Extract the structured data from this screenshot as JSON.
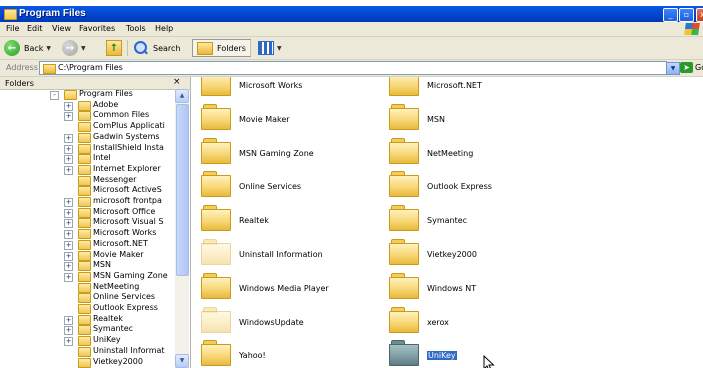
{
  "window": {
    "title": "Program Files",
    "buttons": {
      "minimize": "_",
      "maximize": "▫",
      "close": "x"
    }
  },
  "menu": [
    "File",
    "Edit",
    "View",
    "Favorites",
    "Tools",
    "Help"
  ],
  "toolbar": {
    "back": "Back",
    "search": "Search",
    "folders": "Folders"
  },
  "address": {
    "label": "Address",
    "value": "C:\\Program Files",
    "go": "Go"
  },
  "folders_pane": {
    "title": "Folders",
    "close": "×",
    "tree": [
      {
        "label": "Program Files",
        "expander": "-",
        "level": 0
      },
      {
        "label": "Adobe",
        "expander": "+",
        "level": 1
      },
      {
        "label": "Common Files",
        "expander": "+",
        "level": 1
      },
      {
        "label": "ComPlus Applicati",
        "expander": "",
        "level": 1
      },
      {
        "label": "Gadwin Systems",
        "expander": "+",
        "level": 1
      },
      {
        "label": "InstallShield Insta",
        "expander": "+",
        "level": 1
      },
      {
        "label": "Intel",
        "expander": "+",
        "level": 1
      },
      {
        "label": "Internet Explorer",
        "expander": "+",
        "level": 1
      },
      {
        "label": "Messenger",
        "expander": "",
        "level": 1
      },
      {
        "label": "Microsoft ActiveS",
        "expander": "",
        "level": 1
      },
      {
        "label": "microsoft frontpa",
        "expander": "+",
        "level": 1
      },
      {
        "label": "Microsoft Office",
        "expander": "+",
        "level": 1
      },
      {
        "label": "Microsoft Visual S",
        "expander": "+",
        "level": 1
      },
      {
        "label": "Microsoft Works",
        "expander": "+",
        "level": 1
      },
      {
        "label": "Microsoft.NET",
        "expander": "+",
        "level": 1
      },
      {
        "label": "Movie Maker",
        "expander": "+",
        "level": 1
      },
      {
        "label": "MSN",
        "expander": "+",
        "level": 1
      },
      {
        "label": "MSN Gaming Zone",
        "expander": "+",
        "level": 1
      },
      {
        "label": "NetMeeting",
        "expander": "",
        "level": 1
      },
      {
        "label": "Online Services",
        "expander": "",
        "level": 1
      },
      {
        "label": "Outlook Express",
        "expander": "",
        "level": 1
      },
      {
        "label": "Realtek",
        "expander": "+",
        "level": 1
      },
      {
        "label": "Symantec",
        "expander": "+",
        "level": 1
      },
      {
        "label": "UniKey",
        "expander": "+",
        "level": 1
      },
      {
        "label": "Uninstall Informat",
        "expander": "",
        "level": 1
      },
      {
        "label": "Vietkey2000",
        "expander": "",
        "level": 1
      }
    ]
  },
  "content": {
    "items": [
      {
        "label": "Microsoft Works",
        "style": "normal"
      },
      {
        "label": "Microsoft.NET",
        "style": "normal"
      },
      {
        "label": "Movie Maker",
        "style": "normal"
      },
      {
        "label": "MSN",
        "style": "normal"
      },
      {
        "label": "MSN Gaming Zone",
        "style": "normal"
      },
      {
        "label": "NetMeeting",
        "style": "normal"
      },
      {
        "label": "Online Services",
        "style": "normal"
      },
      {
        "label": "Outlook Express",
        "style": "normal"
      },
      {
        "label": "Realtek",
        "style": "normal"
      },
      {
        "label": "Symantec",
        "style": "normal"
      },
      {
        "label": "Uninstall Information",
        "style": "faded"
      },
      {
        "label": "Vietkey2000",
        "style": "normal"
      },
      {
        "label": "Windows Media Player",
        "style": "normal"
      },
      {
        "label": "Windows NT",
        "style": "normal"
      },
      {
        "label": "WindowsUpdate",
        "style": "faded"
      },
      {
        "label": "xerox",
        "style": "normal"
      },
      {
        "label": "Yahoo!",
        "style": "normal"
      },
      {
        "label": "UniKey",
        "style": "selected"
      }
    ]
  }
}
